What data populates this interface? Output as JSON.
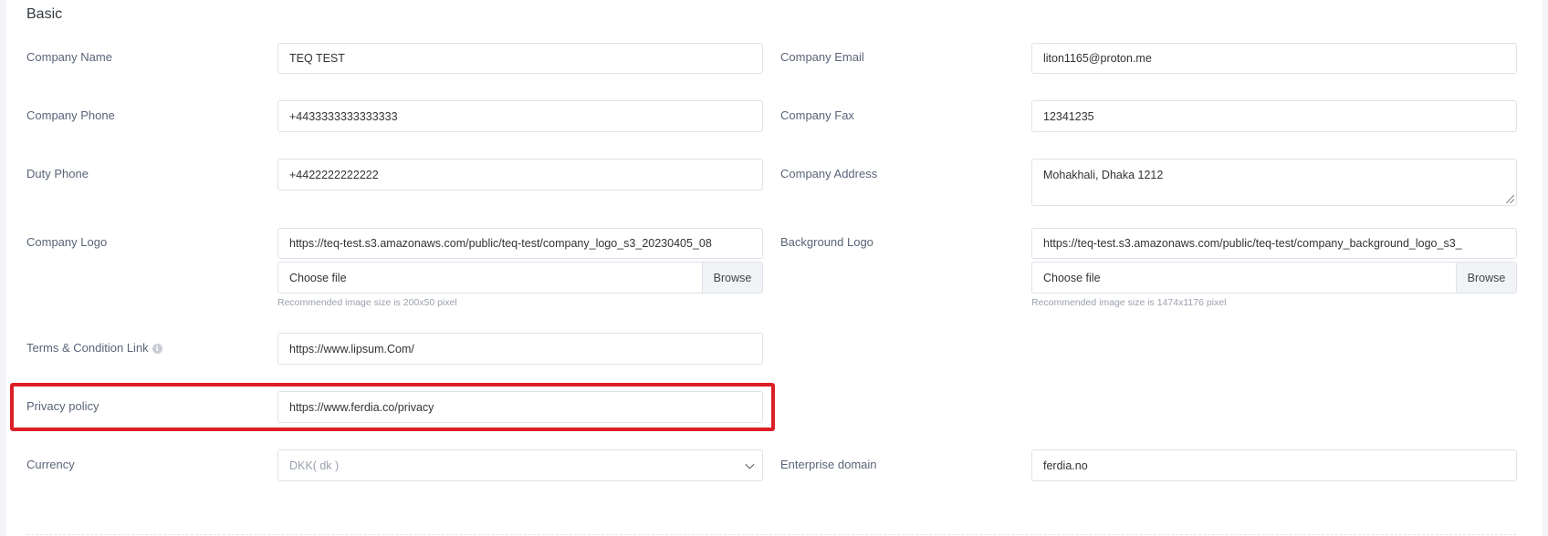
{
  "section": {
    "title": "Basic"
  },
  "fields": {
    "company_name": {
      "label": "Company Name",
      "value": "TEQ TEST"
    },
    "company_email": {
      "label": "Company Email",
      "value": "liton1165@proton.me"
    },
    "company_phone": {
      "label": "Company Phone",
      "value": "+4433333333333333"
    },
    "company_fax": {
      "label": "Company Fax",
      "value": "12341235"
    },
    "duty_phone": {
      "label": "Duty Phone",
      "value": "+4422222222222"
    },
    "company_address": {
      "label": "Company Address",
      "value": "Mohakhali, Dhaka 1212"
    },
    "company_logo": {
      "label": "Company Logo",
      "value": "https://teq-test.s3.amazonaws.com/public/teq-test/company_logo_s3_20230405_08",
      "file_placeholder": "Choose file",
      "browse_label": "Browse",
      "hint": "Recommended image size is 200x50 pixel"
    },
    "background_logo": {
      "label": "Background Logo",
      "value": "https://teq-test.s3.amazonaws.com/public/teq-test/company_background_logo_s3_",
      "file_placeholder": "Choose file",
      "browse_label": "Browse",
      "hint": "Recommended image size is 1474x1176 pixel"
    },
    "terms_link": {
      "label": "Terms & Condition Link",
      "value": "https://www.lipsum.Com/"
    },
    "privacy_policy": {
      "label": "Privacy policy",
      "value": "https://www.ferdia.co/privacy"
    },
    "currency": {
      "label": "Currency",
      "value": "DKK( dk )"
    },
    "enterprise_domain": {
      "label": "Enterprise domain",
      "value": "ferdia.no"
    }
  },
  "icons": {
    "terms_info": "info-icon",
    "currency_dropdown": "chevron-down-icon"
  },
  "colors": {
    "highlight": "#dc1f26",
    "label": "#5a6478",
    "border": "#dfe2e8"
  }
}
